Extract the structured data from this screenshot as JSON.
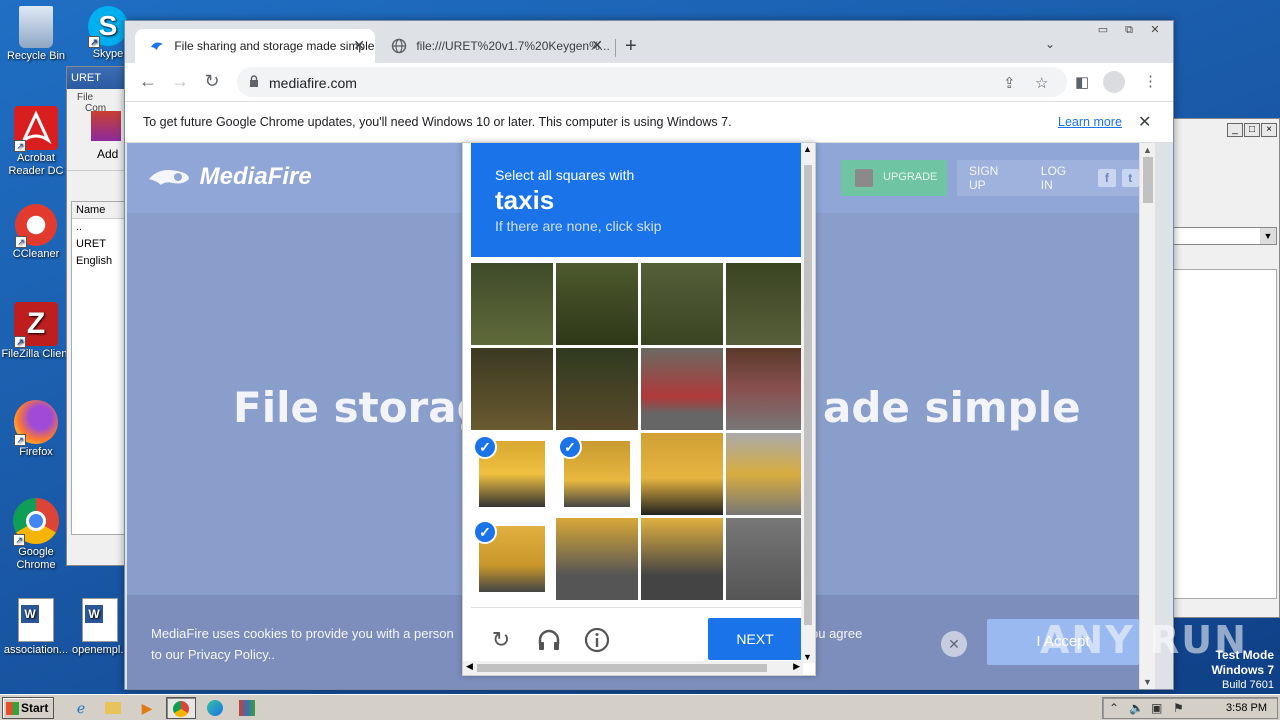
{
  "desktop": {
    "icons": [
      {
        "label": "Recycle Bin",
        "icon": "recycle-bin-icon"
      },
      {
        "label": "Acrobat Reader DC",
        "icon": "acrobat-icon"
      },
      {
        "label": "CCleaner",
        "icon": "ccleaner-icon"
      },
      {
        "label": "FileZilla Client",
        "icon": "filezilla-icon"
      },
      {
        "label": "Firefox",
        "icon": "firefox-icon"
      },
      {
        "label": "Google Chrome",
        "icon": "chrome-icon"
      },
      {
        "label": "association...",
        "icon": "word-doc-icon"
      },
      {
        "label": "openempl...",
        "icon": "word-doc-icon"
      },
      {
        "label": "Skype",
        "icon": "skype-icon"
      }
    ]
  },
  "winrar": {
    "title": "URET",
    "menu": [
      "File",
      "Com"
    ],
    "add_label": "Add",
    "column_name": "Name",
    "rows": [
      "..",
      "URET",
      "English"
    ]
  },
  "chrome": {
    "tabs": [
      {
        "title": "File sharing and storage made simple",
        "active": true
      },
      {
        "title": "file:///URET%20v1.7%20Keygen%...",
        "active": false
      }
    ],
    "url": "mediafire.com",
    "infobar": {
      "message": "To get future Google Chrome updates, you'll need Windows 10 or later. This computer is using Windows 7.",
      "link": "Learn more"
    }
  },
  "mediafire": {
    "logo": "MediaFire",
    "upgrade": "UPGRADE",
    "signup": "SIGN UP",
    "login": "LOG IN",
    "facebook": "f",
    "twitter": "t",
    "hero_left": "File storag",
    "hero_right": "ade simple",
    "cookie_text_left": "MediaFire uses cookies to provide you with a person",
    "cookie_text_right": "ou agree",
    "cookie_text_line2": "to our Privacy Policy..",
    "accept": "I Accept"
  },
  "captcha": {
    "instruction": "Select all squares with",
    "target": "taxis",
    "hint": "If there are none, click skip",
    "selected_tiles": [
      8,
      9,
      12
    ],
    "next_label": "NEXT"
  },
  "watermark": "ANY RUN",
  "testmode": {
    "line1": "Test Mode",
    "line2": "Windows 7",
    "line3": "Build 7601"
  },
  "taskbar": {
    "start": "Start",
    "clock": "3:58 PM"
  }
}
